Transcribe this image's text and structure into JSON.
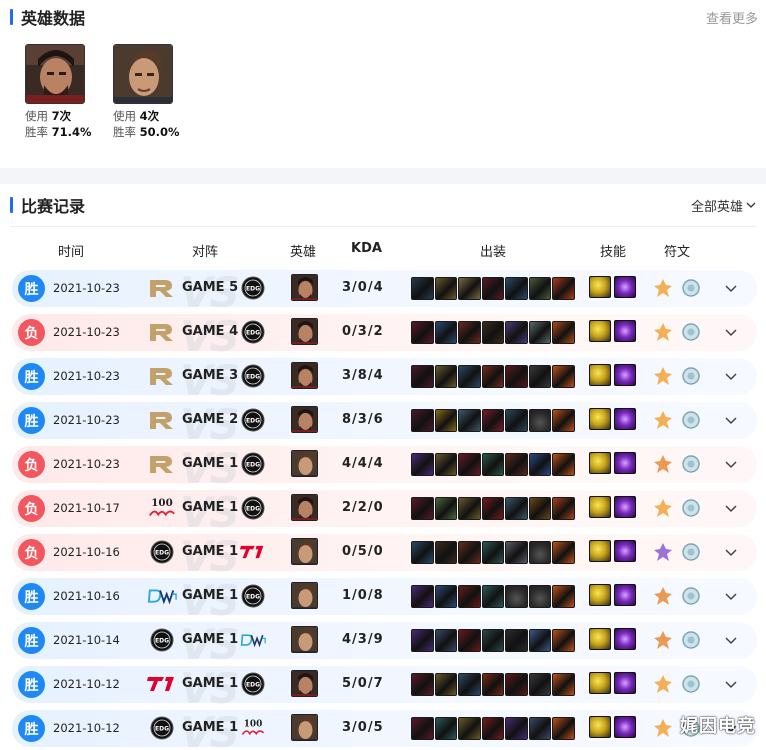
{
  "hero_section": {
    "title": "英雄数据",
    "more": "查看更多",
    "heroes": [
      {
        "name": "graves",
        "use_label": "使用",
        "use_value": "7次",
        "win_label": "胜率",
        "win_value": "71.4%"
      },
      {
        "name": "jayce",
        "use_label": "使用",
        "use_value": "4次",
        "win_label": "胜率",
        "win_value": "50.0%"
      }
    ]
  },
  "match_section": {
    "title": "比赛记录",
    "filter": "全部英雄",
    "headers": {
      "time": "时间",
      "matchup": "对阵",
      "hero": "英雄",
      "kda": "KDA",
      "build": "出装",
      "skills": "技能",
      "runes": "符文"
    },
    "vs_text": "VS",
    "rows": [
      {
        "result": "胜",
        "outcome": "win",
        "date": "2021-10-23",
        "team_a": "RNG",
        "game": "GAME 5",
        "team_b": "EDG",
        "champ": "graves",
        "kda": "3/0/4"
      },
      {
        "result": "负",
        "outcome": "loss",
        "date": "2021-10-23",
        "team_a": "RNG",
        "game": "GAME 4",
        "team_b": "EDG",
        "champ": "graves",
        "kda": "0/3/2"
      },
      {
        "result": "胜",
        "outcome": "win",
        "date": "2021-10-23",
        "team_a": "RNG",
        "game": "GAME 3",
        "team_b": "EDG",
        "champ": "graves",
        "kda": "3/8/4"
      },
      {
        "result": "胜",
        "outcome": "win",
        "date": "2021-10-23",
        "team_a": "RNG",
        "game": "GAME 2",
        "team_b": "EDG",
        "champ": "graves",
        "kda": "8/3/6"
      },
      {
        "result": "负",
        "outcome": "loss",
        "date": "2021-10-23",
        "team_a": "RNG",
        "game": "GAME 1",
        "team_b": "EDG",
        "champ": "jayce",
        "kda": "4/4/4"
      },
      {
        "result": "负",
        "outcome": "loss",
        "date": "2021-10-17",
        "team_a": "100",
        "game": "GAME 1",
        "team_b": "EDG",
        "champ": "graves",
        "kda": "2/2/0"
      },
      {
        "result": "负",
        "outcome": "loss",
        "date": "2021-10-16",
        "team_a": "EDG",
        "game": "GAME 1",
        "team_b": "T1",
        "champ": "jayce",
        "kda": "0/5/0"
      },
      {
        "result": "胜",
        "outcome": "win",
        "date": "2021-10-16",
        "team_a": "DWG",
        "game": "GAME 1",
        "team_b": "EDG",
        "champ": "jayce",
        "kda": "1/0/8"
      },
      {
        "result": "胜",
        "outcome": "win",
        "date": "2021-10-14",
        "team_a": "EDG",
        "game": "GAME 1",
        "team_b": "DWG",
        "champ": "jayce",
        "kda": "4/3/9"
      },
      {
        "result": "胜",
        "outcome": "win",
        "date": "2021-10-12",
        "team_a": "T1",
        "game": "GAME 1",
        "team_b": "EDG",
        "champ": "graves",
        "kda": "5/0/7"
      },
      {
        "result": "胜",
        "outcome": "win",
        "date": "2021-10-12",
        "team_a": "EDG",
        "game": "GAME 1",
        "team_b": "100",
        "champ": "jayce",
        "kda": "3/0/5"
      }
    ]
  },
  "watermark": "娓因电竞",
  "colors": {
    "accent": "#1e6ff0",
    "win": "#1e88f5",
    "loss": "#f2565e"
  }
}
